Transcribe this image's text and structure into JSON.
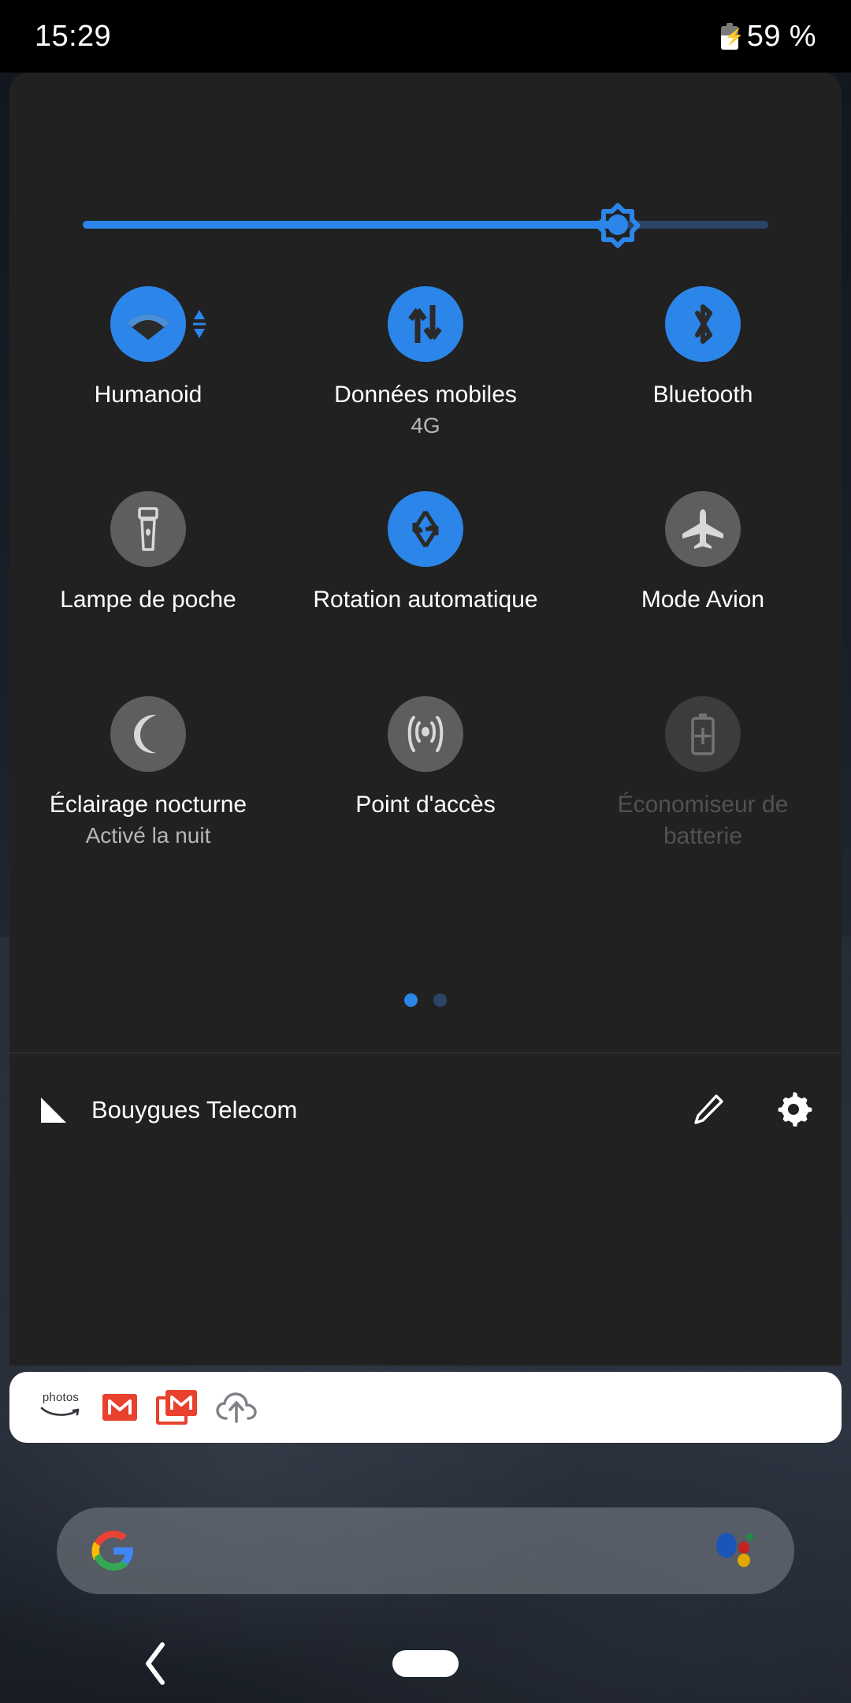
{
  "status_bar": {
    "time": "15:29",
    "battery_percent": "59 %",
    "battery_icon": "battery-charging-icon",
    "battery_level": 59,
    "charging": true
  },
  "quick_settings": {
    "brightness": {
      "name": "brightness-slider",
      "value_percent": 78,
      "thumb_icon": "brightness-sun-icon",
      "fill_color": "#2c85e8",
      "track_color": "#2a4566"
    },
    "tiles": [
      {
        "id": "wifi",
        "label": "Humanoid",
        "sublabel": "",
        "icon": "wifi-icon",
        "state": "on",
        "has_expand": true,
        "enabled": true
      },
      {
        "id": "mobile-data",
        "label": "Données mobiles",
        "sublabel": "4G",
        "icon": "mobile-data-icon",
        "state": "on",
        "has_expand": false,
        "enabled": true
      },
      {
        "id": "bluetooth",
        "label": "Bluetooth",
        "sublabel": "",
        "icon": "bluetooth-icon",
        "state": "on",
        "has_expand": false,
        "enabled": true
      },
      {
        "id": "flashlight",
        "label": "Lampe de poche",
        "sublabel": "",
        "icon": "flashlight-icon",
        "state": "off",
        "has_expand": false,
        "enabled": true
      },
      {
        "id": "auto-rotate",
        "label": "Rotation automatique",
        "sublabel": "",
        "icon": "auto-rotate-icon",
        "state": "on",
        "has_expand": false,
        "enabled": true
      },
      {
        "id": "airplane-mode",
        "label": "Mode Avion",
        "sublabel": "",
        "icon": "airplane-icon",
        "state": "off",
        "has_expand": false,
        "enabled": true
      },
      {
        "id": "night-light",
        "label": "Éclairage nocturne",
        "sublabel": "Activé la nuit",
        "icon": "moon-icon",
        "state": "off",
        "has_expand": false,
        "enabled": true
      },
      {
        "id": "hotspot",
        "label": "Point d'accès",
        "sublabel": "",
        "icon": "hotspot-icon",
        "state": "off",
        "has_expand": false,
        "enabled": true
      },
      {
        "id": "battery-saver",
        "label": "Économiseur de batterie",
        "sublabel": "",
        "icon": "battery-saver-icon",
        "state": "off",
        "has_expand": false,
        "enabled": false
      }
    ],
    "pages": {
      "total": 2,
      "active": 1
    },
    "footer": {
      "signal_icon": "signal-triangle-icon",
      "carrier": "Bouygues Telecom",
      "edit_icon": "pencil-edit-icon",
      "settings_icon": "gear-settings-icon"
    }
  },
  "notification_shade": {
    "icons": [
      {
        "name": "amazon-photos-icon",
        "word": "photos"
      },
      {
        "name": "gmail-icon",
        "letter": "M"
      },
      {
        "name": "gmail-stacked-icon",
        "letter": "M"
      },
      {
        "name": "cloud-upload-icon"
      }
    ]
  },
  "home_screen": {
    "search_bar": {
      "name": "google-search-bar",
      "placeholder": "",
      "value": "",
      "logo_icon": "google-g-icon",
      "assistant_icon": "google-assistant-icon"
    }
  },
  "nav_bar": {
    "back_icon": "back-chevron-icon",
    "home_icon": "home-pill-icon"
  },
  "colors": {
    "accent": "#2c85e8",
    "panel_bg": "#212121",
    "tile_off": "#5e5e5e",
    "text_primary": "#ffffff",
    "text_secondary": "#b6b6b6"
  }
}
